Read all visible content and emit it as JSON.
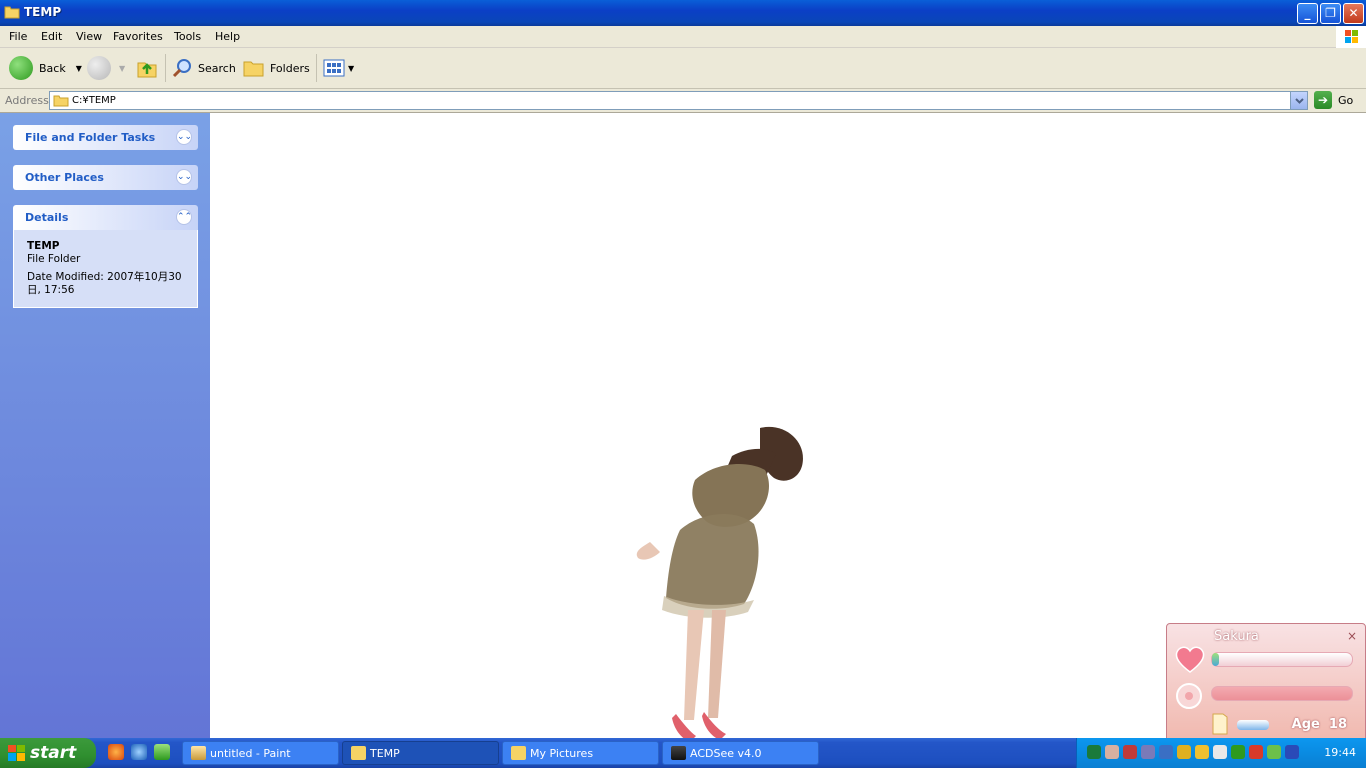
{
  "window": {
    "title": "TEMP"
  },
  "menu": [
    "File",
    "Edit",
    "View",
    "Favorites",
    "Tools",
    "Help"
  ],
  "toolbar": {
    "back": "Back",
    "search": "Search",
    "folders": "Folders"
  },
  "address": {
    "label": "Address",
    "value": "C:¥TEMP",
    "go": "Go"
  },
  "sidebar": {
    "tasks_title": "File and Folder Tasks",
    "places_title": "Other Places",
    "details_title": "Details",
    "details_name": "TEMP",
    "details_type": "File Folder",
    "details_modified": "Date Modified: 2007年10月30日, 17:56"
  },
  "taskbar": {
    "start": "start",
    "tasks": [
      "untitled - Paint",
      "TEMP",
      "My Pictures",
      "ACDSee v4.0"
    ],
    "clock": "19:44"
  },
  "widget": {
    "name": "Sakura",
    "close": "×",
    "age_label": "Age",
    "age_value": "18",
    "heart_level": 0.05
  },
  "colors": {
    "title_blue": "#0b3fc6",
    "sidebar": "#6375d6",
    "start_green": "#2f8f2f",
    "taskbar": "#2456c8"
  }
}
